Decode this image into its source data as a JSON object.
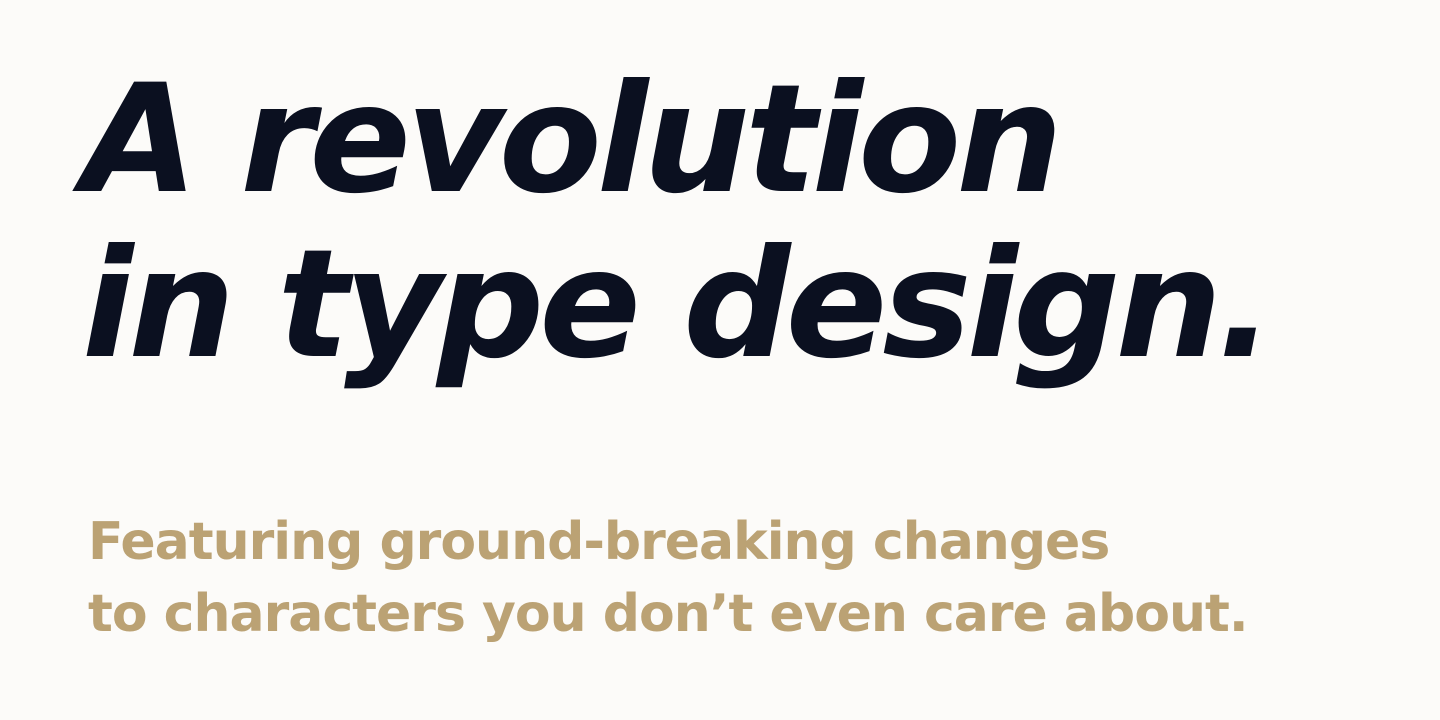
{
  "hero": {
    "headline_line_1": "A revolution",
    "headline_line_2": "in type design.",
    "subhead_line_1": "Featuring ground-breaking changes",
    "subhead_line_2": "to characters you don’t even care about."
  },
  "colors": {
    "background": "#fcfbf9",
    "headline": "#0b1020",
    "subhead": "#bba274"
  }
}
